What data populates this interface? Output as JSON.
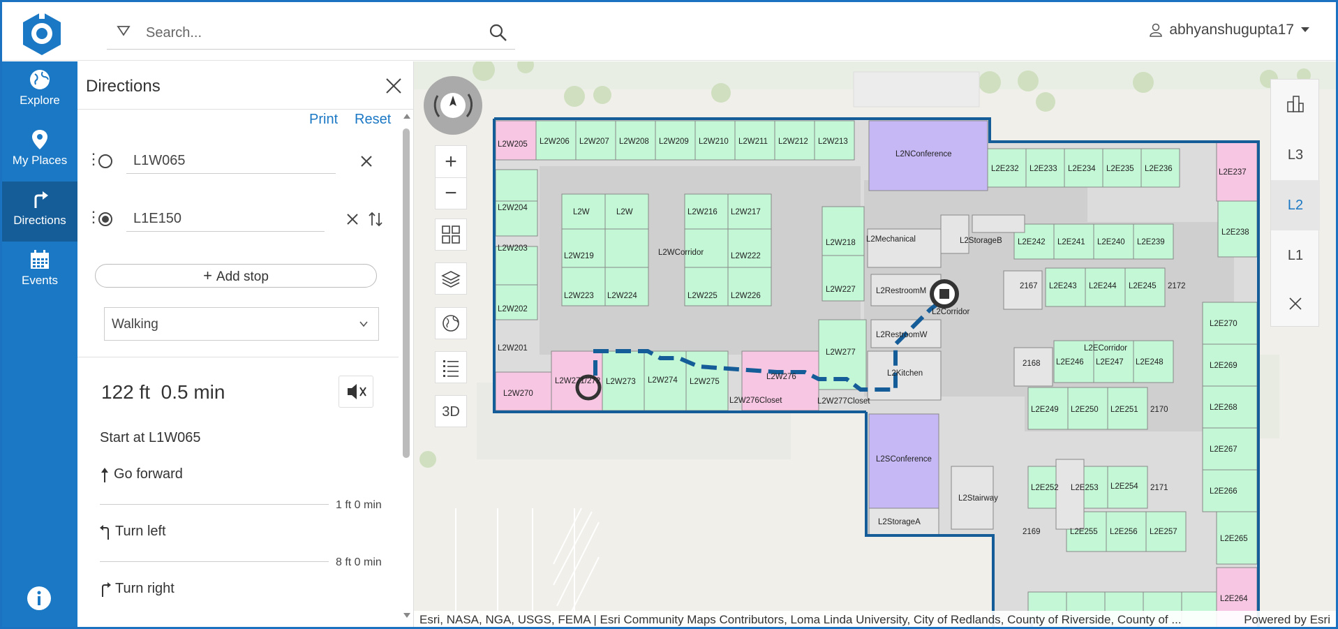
{
  "header": {
    "search_placeholder": "Search...",
    "username": "abhyanshugupta17"
  },
  "nav": {
    "items": [
      {
        "label": "Explore",
        "icon": "globe-icon"
      },
      {
        "label": "My Places",
        "icon": "map-pin-icon"
      },
      {
        "label": "Directions",
        "icon": "turn-arrow-icon",
        "active": true
      },
      {
        "label": "Events",
        "icon": "calendar-icon"
      }
    ]
  },
  "directions": {
    "title": "Directions",
    "print_label": "Print",
    "reset_label": "Reset",
    "origin": "L1W065",
    "destination": "L1E150",
    "add_stop_label": "Add stop",
    "mode": "Walking",
    "summary_distance": "122 ft",
    "summary_time": "0.5 min",
    "start_text": "Start at L1W065",
    "steps": [
      {
        "text": "Go forward",
        "meta": "1 ft  0 min"
      },
      {
        "text": "Turn left",
        "meta": "8 ft  0 min"
      },
      {
        "text": "Turn right",
        "meta": ""
      }
    ]
  },
  "map": {
    "floors": [
      "L3",
      "L2",
      "L1"
    ],
    "selected_floor": "L2",
    "tools_3d_label": "3D",
    "attribution": "Esri, NASA, NGA, USGS, FEMA | Esri Community Maps Contributors, Loma Linda University, City of Redlands, County of Riverside, County of ...",
    "powered_by": "Powered by Esri",
    "rooms": [
      "L2W205",
      "L2W206",
      "L2W207",
      "L2W208",
      "L2W209",
      "L2W210",
      "L2W211",
      "L2W212",
      "L2W213",
      "L2NConference",
      "L2E232",
      "L2E233",
      "L2E234",
      "L2E235",
      "L2E236",
      "L2E237",
      "L2W204",
      "L2W203",
      "L2W202",
      "L2W201",
      "L2W270",
      "L2W271/272",
      "L2W273",
      "L2W274",
      "L2W275",
      "L2W276",
      "L2W276Closet",
      "L2W277",
      "L2W277Closet",
      "L2W",
      "L2W219",
      "L2W223",
      "L2W224",
      "L2WCorridor",
      "L2W216",
      "L2W217",
      "L2W222",
      "L2W225",
      "L2W226",
      "L2W218",
      "L2W227",
      "L2Mechanical",
      "L2RestroomM",
      "L2RestroomW",
      "L2Kitchen",
      "L2StorageB",
      "L2Corridor",
      "L2ECorridor",
      "L2E242",
      "L2E241",
      "L2E240",
      "L2E239",
      "L2E238",
      "2167",
      "L2E243",
      "L2E244",
      "L2E245",
      "2172",
      "L2E270",
      "L2E269",
      "L2E268",
      "L2E267",
      "L2E266",
      "L2E265",
      "L2E264",
      "2168",
      "L2E246",
      "L2E247",
      "L2E248",
      "L2E249",
      "L2E250",
      "L2E251",
      "2170",
      "L2SConference",
      "L2Stairway",
      "L2StorageA",
      "L2E252",
      "L2E253",
      "L2E254",
      "2171",
      "2169",
      "L2E255",
      "L2E256",
      "L2E257"
    ]
  },
  "colors": {
    "brand_blue": "#1b78c4",
    "office_green": "#c3f7d6",
    "pink_room": "#f7c6e3",
    "conference_purple": "#c6b8f5",
    "route_blue": "#155d98"
  }
}
